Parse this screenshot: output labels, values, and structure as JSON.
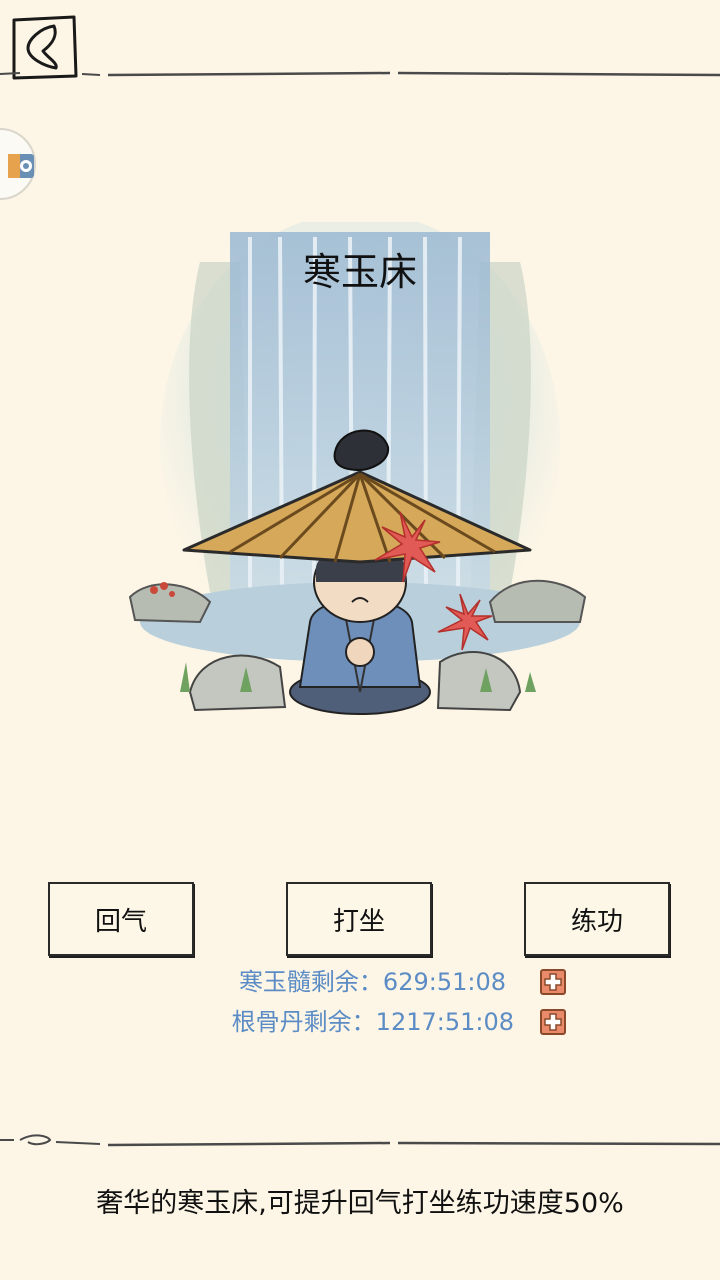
{
  "header": {
    "back_icon": "back-chevron-icon",
    "side_badge_icon": "app-badge-icon"
  },
  "scene": {
    "title": "寒玉床",
    "illustration": "meditating-hero-waterfall"
  },
  "actions": [
    {
      "label": "回气"
    },
    {
      "label": "打坐"
    },
    {
      "label": "练功"
    }
  ],
  "timers": [
    {
      "text": "寒玉髓剩余：629:51:08",
      "add_icon": "plus-icon"
    },
    {
      "text": "根骨丹剩余：1217:51:08",
      "add_icon": "plus-icon"
    }
  ],
  "footer": {
    "description": "奢华的寒玉床,可提升回气打坐练功速度50%"
  },
  "colors": {
    "background": "#fdf6e6",
    "timer_text": "#5b8cc5",
    "plus_button": "#e98a6a"
  }
}
